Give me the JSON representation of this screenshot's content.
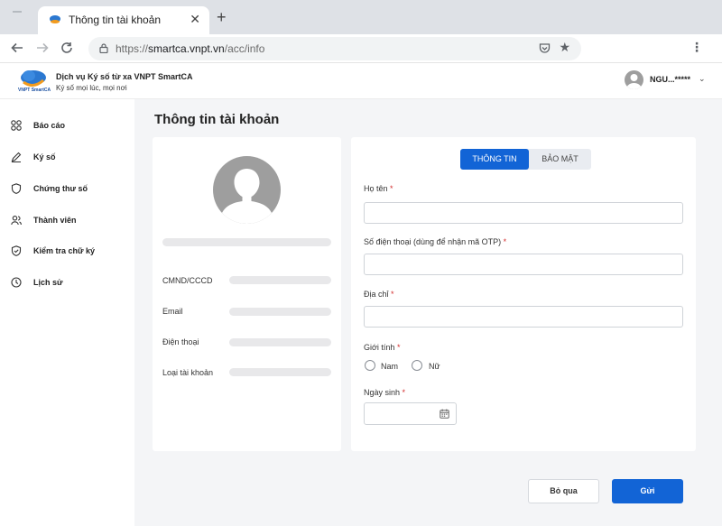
{
  "browser": {
    "tab_title": "Thông tin tài khoản",
    "close_glyph": "✕",
    "new_tab_glyph": "+",
    "url_prefix": "https://",
    "url_host": "smartca.vnpt.vn",
    "url_path": "/acc/info",
    "icons": [
      "back-icon",
      "forward-icon",
      "reload-icon",
      "lock-icon",
      "pocket-icon",
      "star-icon",
      "kebab-menu-icon"
    ]
  },
  "header": {
    "logo_text": "VNPT SmartCA",
    "brand_title": "Dịch vụ Ký số từ xa VNPT SmartCA",
    "brand_subtitle": "Ký số mọi lúc, mọi nơi",
    "user_name": "NGU...*****"
  },
  "sidebar": {
    "items": [
      {
        "label": "Báo cáo",
        "icon": "dashboard-icon"
      },
      {
        "label": "Ký số",
        "icon": "pen-icon"
      },
      {
        "label": "Chứng thư số",
        "icon": "shield-icon"
      },
      {
        "label": "Thành viên",
        "icon": "users-icon"
      },
      {
        "label": "Kiểm tra chữ ký",
        "icon": "shield-check-icon"
      },
      {
        "label": "Lịch sử",
        "icon": "clock-icon"
      }
    ]
  },
  "main": {
    "page_title": "Thông tin tài khoản",
    "profile": {
      "fields": [
        "CMND/CCCD",
        "Email",
        "Điện thoại",
        "Loại tài khoản"
      ]
    },
    "tabs": {
      "active": "THÔNG TIN",
      "inactive": "BẢO MẬT"
    },
    "form": {
      "name_label": "Họ tên",
      "phone_label": "Số điện thoại (dùng để nhận mã OTP)",
      "address_label": "Địa chỉ",
      "gender_label": "Giới tính",
      "gender_options": [
        "Nam",
        "Nữ"
      ],
      "dob_label": "Ngày sinh",
      "required_mark": "*"
    },
    "buttons": {
      "cancel": "Bỏ qua",
      "submit": "Gửi"
    }
  },
  "colors": {
    "accent": "#1264d6",
    "required": "#d32f2f",
    "background": "#f4f5f7"
  }
}
